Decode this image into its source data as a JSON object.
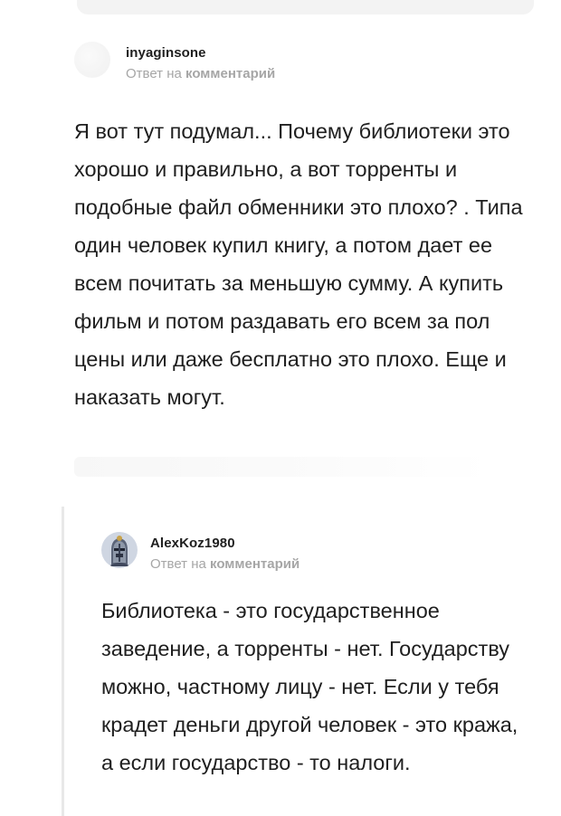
{
  "comments": [
    {
      "username": "inyaginsone",
      "reply_prefix": "Ответ на",
      "reply_target": "комментарий",
      "text": "Я вот тут подумал... Почему библиотеки это хорошо и правильно, а вот торренты и подобные файл обменники это плохо? . Типа один человек купил книгу, а потом дает ее всем почитать за меньшую сумму. А купить фильм и потом раздавать его всем за пол цены или даже бесплатно это плохо. Еще и наказать могут."
    },
    {
      "username": "AlexKoz1980",
      "reply_prefix": "Ответ на",
      "reply_target": "комментарий",
      "text": "Библиотека - это государственное заведение, а торренты - нет. Государству можно, частному лицу - нет. Если у тебя крадет деньги другой человек - это кража, а если государство - то налоги."
    }
  ],
  "icons": {
    "avatar_1": "blank-avatar-icon",
    "avatar_2": "knight-helmet-avatar-icon"
  }
}
